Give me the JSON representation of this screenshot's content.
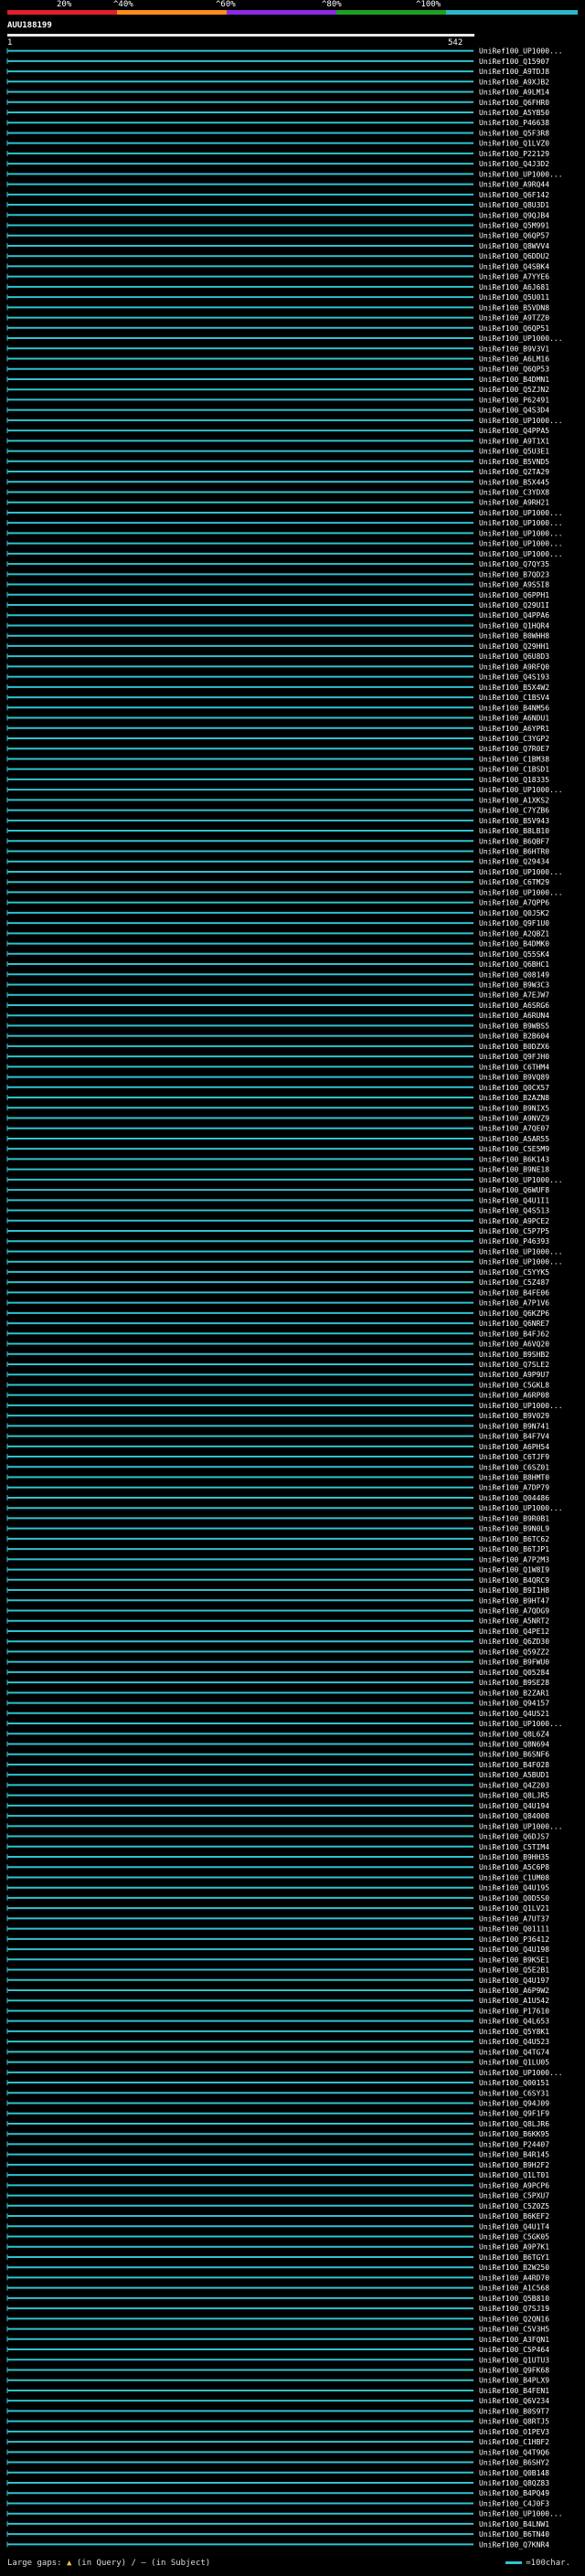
{
  "scale": {
    "ticks": [
      "20%",
      "^40%",
      "^60%",
      "^80%",
      "^100%"
    ],
    "colors": [
      "#e0202a",
      "#ff8c1a",
      "#8a2be2",
      "#1f9e22",
      "#2bb7c8"
    ]
  },
  "query": {
    "name": "AUU188199",
    "start": "1",
    "end": "542"
  },
  "track_color": "#2fc3cf",
  "gap_color": "#1f9e22",
  "hits": [
    "UniRef100_UP1000...",
    "UniRef100_Q15907",
    "UniRef100_A9TDJ8",
    "UniRef100_A9XJB2",
    "UniRef100_A9LM14",
    "UniRef100_Q6FHR0",
    "UniRef100_A5YB50",
    "UniRef100_P46638",
    "UniRef100_Q5F3R8",
    "UniRef100_Q1LVZ0",
    "UniRef100_P22129",
    "UniRef100_Q4J3D2",
    "UniRef100_UP1000...",
    "UniRef100_A9RQ44",
    "UniRef100_Q6F142",
    "UniRef100_Q8U3D1",
    "UniRef100_Q9QJB4",
    "UniRef100_Q5M991",
    "UniRef100_Q6QP57",
    "UniRef100_Q8WVV4",
    "UniRef100_Q6DDU2",
    "UniRef100_Q4SBK4",
    "UniRef100_A7YYE6",
    "UniRef100_A6J681",
    "UniRef100_Q5U011",
    "UniRef100_B5VDN8",
    "UniRef100_A9TZZ0",
    "UniRef100_Q6QP51",
    "UniRef100_UP1000...",
    "UniRef100_B9V3V1",
    "UniRef100_A6LM16",
    "UniRef100_Q6QP53",
    "UniRef100_B4DMN1",
    "UniRef100_Q5ZJN2",
    "UniRef100_P62491",
    "UniRef100_Q4S3D4",
    "UniRef100_UP1000...",
    "UniRef100_Q4PPA5",
    "UniRef100_A9T1X1",
    "UniRef100_Q5U3E1",
    "UniRef100_B5VND5",
    "UniRef100_Q2TA29",
    "UniRef100_B5X445",
    "UniRef100_C3YDX8",
    "UniRef100_A9RH21",
    "UniRef100_UP1000...",
    "UniRef100_UP1000...",
    "UniRef100_UP1000...",
    "UniRef100_UP1000...",
    "UniRef100_UP1000...",
    "UniRef100_Q7QY35",
    "UniRef100_B7QD23",
    "UniRef100_A9S5I8",
    "UniRef100_Q6PPH1",
    "UniRef100_Q29U1I",
    "UniRef100_Q4PPA6",
    "UniRef100_Q1HQR4",
    "UniRef100_B0WHH8",
    "UniRef100_Q29HH1",
    "UniRef100_Q6U8D3",
    "UniRef100_A9RFQ0",
    "UniRef100_Q4S193",
    "UniRef100_B5X4W2",
    "UniRef100_C1BSV4",
    "UniRef100_B4NM56",
    "UniRef100_A6NDU1",
    "UniRef100_A6YPR1",
    "UniRef100_C3YGP2",
    "UniRef100_Q7R0E7",
    "UniRef100_C1BM38",
    "UniRef100_C1BSD1",
    "UniRef100_Q18335",
    "UniRef100_UP1000...",
    "UniRef100_A1XKS2",
    "UniRef100_C7YZB6",
    "UniRef100_B5V943",
    "UniRef100_B8LB10",
    "UniRef100_B6QBF7",
    "UniRef100_B6HTR0",
    "UniRef100_Q29434",
    "UniRef100_UP1000...",
    "UniRef100_C6TM29",
    "UniRef100_UP1000...",
    "UniRef100_A7QPP6",
    "UniRef100_Q0J5K2",
    "UniRef100_Q9F1U0",
    "UniRef100_A2QBZ1",
    "UniRef100_B4DMK0",
    "UniRef100_Q55SK4",
    "UniRef100_Q6BHC1",
    "UniRef100_Q08149",
    "UniRef100_B9W3C3",
    "UniRef100_A7EJW7",
    "UniRef100_A6SRG6",
    "UniRef100_A6RUN4",
    "UniRef100_B9WBS5",
    "UniRef100_B2B604",
    "UniRef100_B0DZX6",
    "UniRef100_Q9FJH0",
    "UniRef100_C6THM4",
    "UniRef100_B9VQ89",
    "UniRef100_Q0CX57",
    "UniRef100_B2AZN8",
    "UniRef100_B9NIX5",
    "UniRef100_A9NVZ9",
    "UniRef100_A7QE07",
    "UniRef100_A5AR55",
    "UniRef100_C5E5M9",
    "UniRef100_B6K143",
    "UniRef100_B9NE18",
    "UniRef100_UP1000...",
    "UniRef100_Q6WUF8",
    "UniRef100_Q4U1I1",
    "UniRef100_Q4S513",
    "UniRef100_A9PCE2",
    "UniRef100_C5P7P5",
    "UniRef100_P46393",
    "UniRef100_UP1000...",
    "UniRef100_UP1000...",
    "UniRef100_C5YYK5",
    "UniRef100_C5Z487",
    "UniRef100_B4FE06",
    "UniRef100_A7P1V6",
    "UniRef100_Q6KZP6",
    "UniRef100_Q6NRE7",
    "UniRef100_B4FJ62",
    "UniRef100_A6VQ20",
    "UniRef100_B9SHB2",
    "UniRef100_Q7SLE2",
    "UniRef100_A9P9U7",
    "UniRef100_C5GKL8",
    "UniRef100_A6RP08",
    "UniRef100_UP1000...",
    "UniRef100_B9V029",
    "UniRef100_B9N741",
    "UniRef100_B4F7V4",
    "UniRef100_A6PH54",
    "UniRef100_C6TJF9",
    "UniRef100_C6SZ01",
    "UniRef100_B8HMT0",
    "UniRef100_A7DP79",
    "UniRef100_Q04486",
    "UniRef100_UP1000...",
    "UniRef100_B9R0B1",
    "UniRef100_B9N0L9",
    "UniRef100_B6TC62",
    "UniRef100_B6TJP1",
    "UniRef100_A7P2M3",
    "UniRef100_Q1W8I9",
    "UniRef100_B4QRC9",
    "UniRef100_B9I1H8",
    "UniRef100_B9HT47",
    "UniRef100_A7QDG9",
    "UniRef100_A5NRT2",
    "UniRef100_Q4PE12",
    "UniRef100_Q6ZD30",
    "UniRef100_Q59ZZ2",
    "UniRef100_B9FWU0",
    "UniRef100_Q05284",
    "UniRef100_B9SE28",
    "UniRef100_B2ZAR1",
    "UniRef100_Q94157",
    "UniRef100_Q4U521",
    "UniRef100_UP1000...",
    "UniRef100_Q8L6Z4",
    "UniRef100_Q8N694",
    "UniRef100_B6SNF6",
    "UniRef100_B4F028",
    "UniRef100_A5BUD1",
    "UniRef100_Q4Z203",
    "UniRef100_Q8LJR5",
    "UniRef100_Q4U194",
    "UniRef100_Q84008",
    "UniRef100_UP1000...",
    "UniRef100_Q6DJS7",
    "UniRef100_C5TIM4",
    "UniRef100_B9HH35",
    "UniRef100_A5C6P8",
    "UniRef100_C1UM08",
    "UniRef100_Q4U195",
    "UniRef100_Q0D5S0",
    "UniRef100_Q1LV21",
    "UniRef100_A7UT37",
    "UniRef100_Q01111",
    "UniRef100_P36412",
    "UniRef100_Q4U198",
    "UniRef100_B9K5E1",
    "UniRef100_Q5E2B1",
    "UniRef100_Q4U197",
    "UniRef100_A6P9W2",
    "UniRef100_A1U542",
    "UniRef100_P17610",
    "UniRef100_Q4L653",
    "UniRef100_Q5Y8K1",
    "UniRef100_Q4U523",
    "UniRef100_Q4TG74",
    "UniRef100_Q1LU05",
    "UniRef100_UP1000...",
    "UniRef100_Q00151",
    "UniRef100_C6SY31",
    "UniRef100_Q94J09",
    "UniRef100_Q9F1F9",
    "UniRef100_Q8LJR6",
    "UniRef100_B6KK95",
    "UniRef100_P24407",
    "UniRef100_B4R145",
    "UniRef100_B9H2F2",
    "UniRef100_Q1LT01",
    "UniRef100_A9PCP6",
    "UniRef100_C5PXU7",
    "UniRef100_C5Z0Z5",
    "UniRef100_B6KEF2",
    "UniRef100_Q4U1T4",
    "UniRef100_C5GK05",
    "UniRef100_A9P7K1",
    "UniRef100_B6TGY1",
    "UniRef100_B2W250",
    "UniRef100_A4RD70",
    "UniRef100_A1C568",
    "UniRef100_Q5B810",
    "UniRef100_Q7SJ19",
    "UniRef100_Q2QN16",
    "UniRef100_C5V3H5",
    "UniRef100_A3FQN1",
    "UniRef100_C5P464",
    "UniRef100_Q1UTU3",
    "UniRef100_Q9FK68",
    "UniRef100_B4PLX9",
    "UniRef100_B4FEN1",
    "UniRef100_Q6V234",
    "UniRef100_B0S9T7",
    "UniRef100_Q8RTJ5",
    "UniRef100_O1PEV3",
    "UniRef100_C1HBF2",
    "UniRef100_Q4T9Q6",
    "UniRef100_B6SHY2",
    "UniRef100_Q0B148",
    "UniRef100_Q8QZ83",
    "UniRef100_B4PQ49",
    "UniRef100_C4J0F3",
    "UniRef100_UP1000...",
    "UniRef100_B4LNW1",
    "UniRef100_B6TN40",
    "UniRef100_Q7KNR4"
  ],
  "legend": {
    "gaps_label": "Large gaps:",
    "in_query": "(in Query)",
    "sep": "/",
    "in_subject": "(in Subject)",
    "scale_label": "=100char."
  }
}
